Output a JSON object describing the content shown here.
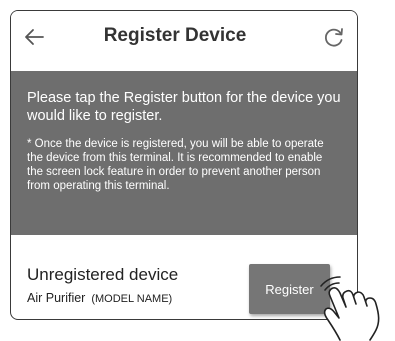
{
  "header": {
    "title": "Register Device",
    "back_icon": "arrow-left-icon",
    "refresh_icon": "refresh-icon"
  },
  "info_panel": {
    "instruction": "Please tap the Register button for the device you would like to register.",
    "note": "* Once the device is registered, you will be able to operate the device from this terminal. It is recommended to enable the screen lock feature in order to prevent another person from operating this terminal."
  },
  "device": {
    "status": "Unregistered device",
    "type": "Air Purifier",
    "model": "(MODEL NAME)",
    "register_label": "Register"
  },
  "colors": {
    "panel_bg": "#6e6e6e",
    "button_bg": "#767676",
    "frame": "#3a3a3a",
    "title_text": "#333333"
  },
  "overlay": {
    "icon": "tapping-hand-icon"
  }
}
